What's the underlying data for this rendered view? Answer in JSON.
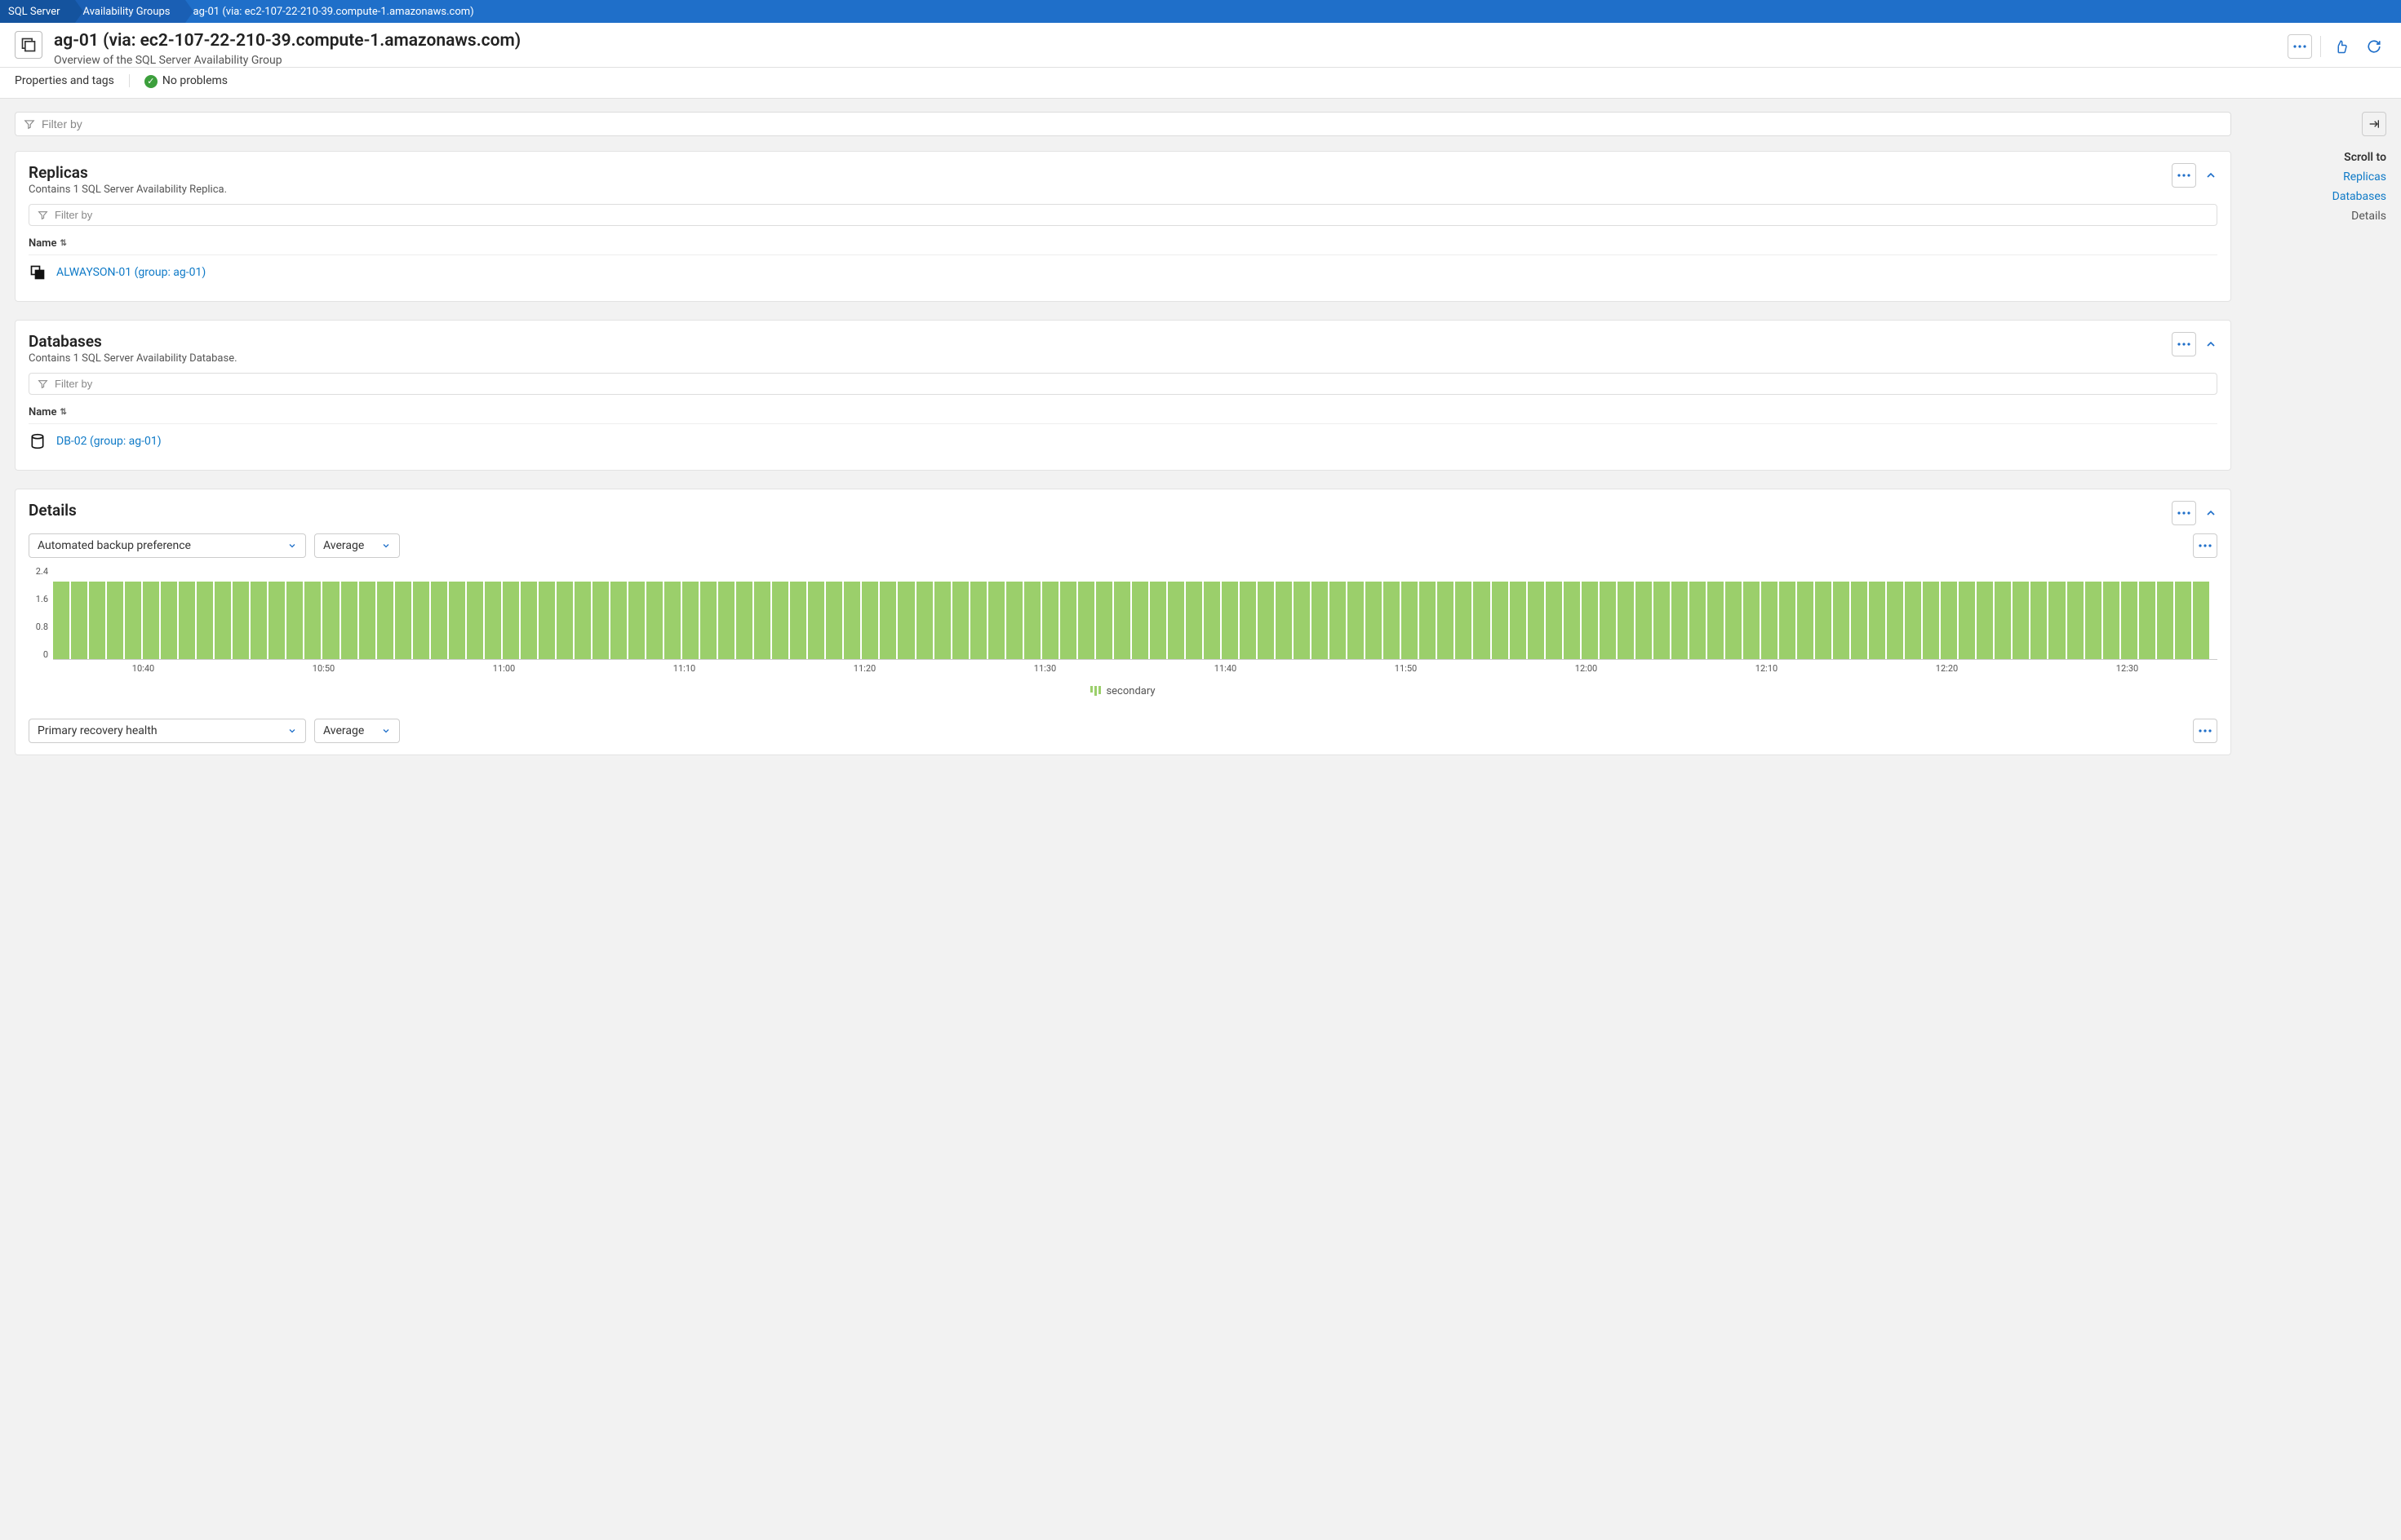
{
  "breadcrumb": [
    "SQL Server",
    "Availability Groups",
    "ag-01 (via: ec2-107-22-210-39.compute-1.amazonaws.com)"
  ],
  "page": {
    "title": "ag-01 (via: ec2-107-22-210-39.compute-1.amazonaws.com)",
    "subtitle": "Overview of the SQL Server Availability Group"
  },
  "status": {
    "props_label": "Properties and tags",
    "problems_label": "No problems"
  },
  "filters": {
    "main_placeholder": "Filter by",
    "inner_placeholder": "Filter by"
  },
  "replicas": {
    "title": "Replicas",
    "sub": "Contains 1 SQL Server Availability Replica.",
    "col_name": "Name",
    "rows": [
      {
        "label": "ALWAYSON-01 (group: ag-01)"
      }
    ]
  },
  "databases": {
    "title": "Databases",
    "sub": "Contains 1 SQL Server Availability Database.",
    "col_name": "Name",
    "rows": [
      {
        "label": "DB-02 (group: ag-01)"
      }
    ]
  },
  "details": {
    "title": "Details",
    "metric1": "Automated backup preference",
    "metric2": "Primary recovery health",
    "agg": "Average",
    "legend": "secondary"
  },
  "side": {
    "title": "Scroll to",
    "links": [
      {
        "label": "Replicas",
        "active": true
      },
      {
        "label": "Databases",
        "active": true
      },
      {
        "label": "Details",
        "active": false
      }
    ]
  },
  "chart_data": {
    "type": "bar",
    "title": "Automated backup preference",
    "ylabel": "",
    "ylim": [
      0,
      2.4
    ],
    "y_ticks": [
      2.4,
      1.6,
      0.8,
      0
    ],
    "x_ticks": [
      "10:40",
      "10:50",
      "11:00",
      "11:10",
      "11:20",
      "11:30",
      "11:40",
      "11:50",
      "12:00",
      "12:10",
      "12:20",
      "12:30"
    ],
    "series": [
      {
        "name": "secondary",
        "values": [
          2,
          2,
          2,
          2,
          2,
          2,
          2,
          2,
          2,
          2,
          2,
          2,
          2,
          2,
          2,
          2,
          2,
          2,
          2,
          2,
          2,
          2,
          2,
          2,
          2,
          2,
          2,
          2,
          2,
          2,
          2,
          2,
          2,
          2,
          2,
          2,
          2,
          2,
          2,
          2,
          2,
          2,
          2,
          2,
          2,
          2,
          2,
          2,
          2,
          2,
          2,
          2,
          2,
          2,
          2,
          2,
          2,
          2,
          2,
          2,
          2,
          2,
          2,
          2,
          2,
          2,
          2,
          2,
          2,
          2,
          2,
          2,
          2,
          2,
          2,
          2,
          2,
          2,
          2,
          2,
          2,
          2,
          2,
          2,
          2,
          2,
          2,
          2,
          2,
          2,
          2,
          2,
          2,
          2,
          2,
          2,
          2,
          2,
          2,
          2,
          2,
          2,
          2,
          2,
          2,
          2,
          2,
          2,
          2,
          2,
          2,
          2,
          2,
          2,
          2,
          2,
          2,
          2,
          2,
          2
        ]
      }
    ]
  }
}
